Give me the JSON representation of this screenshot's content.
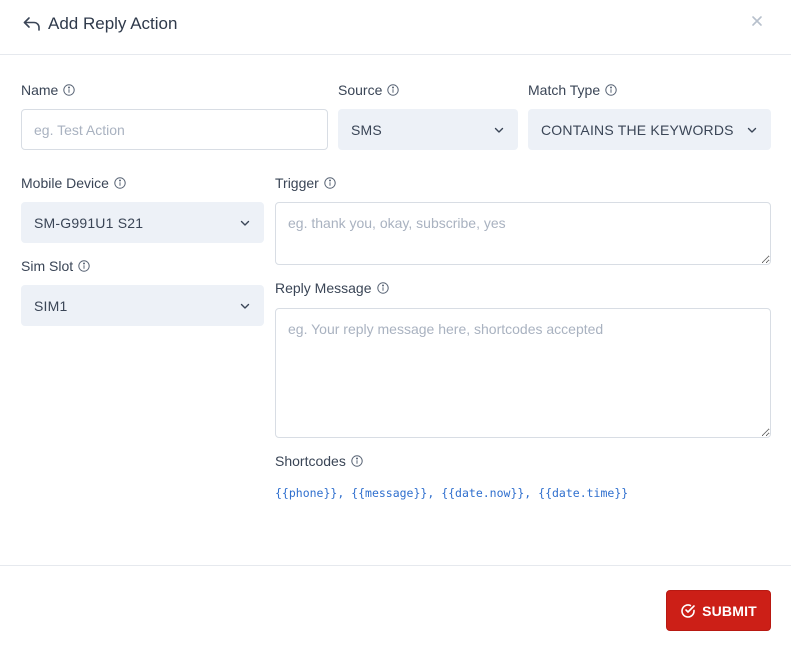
{
  "header": {
    "title": "Add Reply Action"
  },
  "form": {
    "name": {
      "label": "Name",
      "value": "",
      "placeholder": "eg. Test Action"
    },
    "source": {
      "label": "Source",
      "selected": "SMS"
    },
    "match_type": {
      "label": "Match Type",
      "selected": "CONTAINS THE KEYWORDS"
    },
    "mobile_device": {
      "label": "Mobile Device",
      "selected": "SM-G991U1 S21"
    },
    "sim_slot": {
      "label": "Sim Slot",
      "selected": "SIM1"
    },
    "trigger": {
      "label": "Trigger",
      "value": "",
      "placeholder": "eg. thank you, okay, subscribe, yes"
    },
    "reply_message": {
      "label": "Reply Message",
      "value": "",
      "placeholder": "eg. Your reply message here, shortcodes accepted"
    },
    "shortcodes": {
      "label": "Shortcodes",
      "items": [
        "{{phone}}",
        "{{message}}",
        "{{date.now}}",
        "{{date.time}}"
      ],
      "separator": ", "
    }
  },
  "footer": {
    "submit_label": "SUBMIT"
  },
  "colors": {
    "accent_blue": "#2f6fce",
    "submit_red": "#cc1f17",
    "select_bg": "#edf1f7"
  }
}
